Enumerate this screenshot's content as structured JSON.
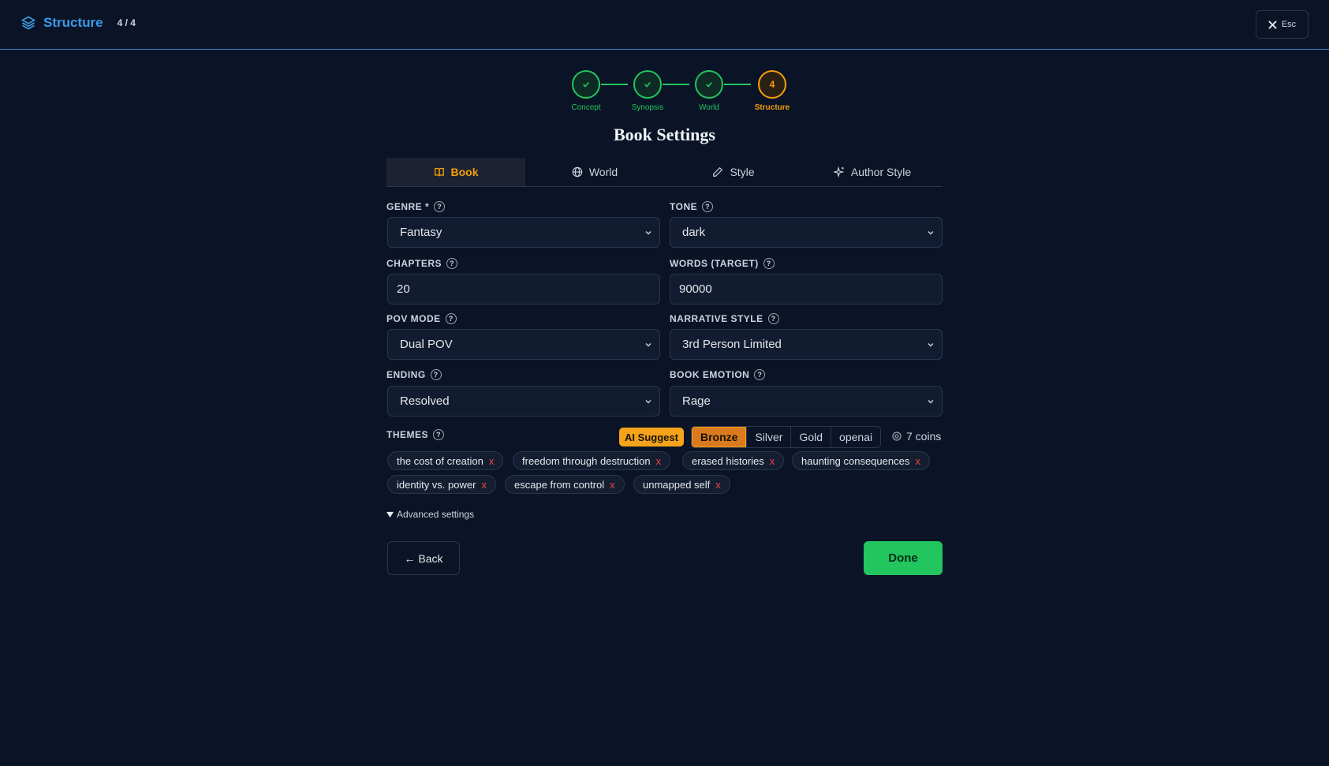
{
  "header": {
    "title": "Structure",
    "step_counter": "4 / 4",
    "close_label": "Esc"
  },
  "stepper": [
    {
      "label": "Concept",
      "status": "done"
    },
    {
      "label": "Synopsis",
      "status": "done"
    },
    {
      "label": "World",
      "status": "done"
    },
    {
      "label": "Structure",
      "status": "active",
      "number": "4"
    }
  ],
  "page_title": "Book Settings",
  "tabs": [
    {
      "label": "Book",
      "icon": "book-icon",
      "active": true
    },
    {
      "label": "World",
      "icon": "globe-icon"
    },
    {
      "label": "Style",
      "icon": "pencil-icon"
    },
    {
      "label": "Author Style",
      "icon": "sparkle-icon"
    }
  ],
  "fields": {
    "genre": {
      "label": "GENRE *",
      "value": "Fantasy"
    },
    "tone": {
      "label": "TONE",
      "value": "dark"
    },
    "chapters": {
      "label": "CHAPTERS",
      "value": "20"
    },
    "words": {
      "label": "WORDS (TARGET)",
      "value": "90000"
    },
    "pov": {
      "label": "POV MODE",
      "value": "Dual POV"
    },
    "narrative": {
      "label": "NARRATIVE STYLE",
      "value": "3rd Person Limited"
    },
    "ending": {
      "label": "ENDING",
      "value": "Resolved"
    },
    "emotion": {
      "label": "BOOK EMOTION",
      "value": "Rage"
    }
  },
  "help_glyph": "?",
  "themes": {
    "label": "THEMES",
    "ai_suggest": "AI Suggest",
    "tiers": [
      "Bronze",
      "Silver",
      "Gold",
      "openai"
    ],
    "coins": "7 coins",
    "remove_glyph": "x",
    "items": [
      "the cost of creation",
      "freedom through destruction",
      "erased histories",
      "haunting consequences",
      "identity vs. power",
      "escape from control",
      "unmapped self"
    ]
  },
  "advanced_label": "Advanced settings",
  "back_label": "← Back",
  "done_label": "Done",
  "colors": {
    "accent": "#f59e0b",
    "success": "#22c55e",
    "brand": "#3b9ae6",
    "background": "#0b1426"
  }
}
